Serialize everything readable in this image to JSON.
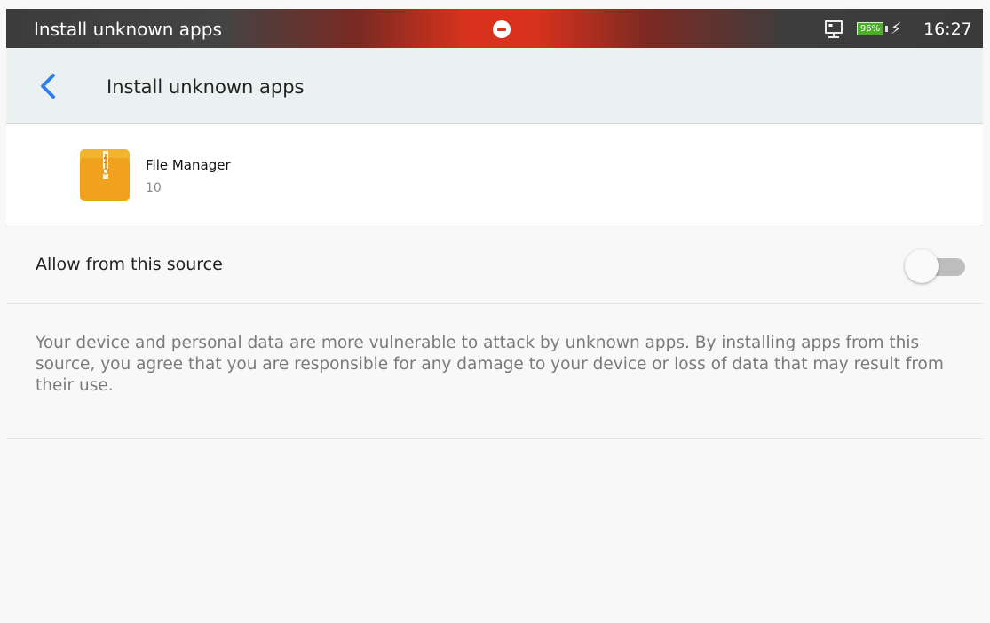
{
  "status_bar": {
    "title": "Install unknown apps",
    "battery_level": "96%",
    "time": "16:27",
    "icons": [
      "do-not-disturb-icon",
      "ethernet-icon",
      "battery-icon",
      "charging-icon"
    ]
  },
  "app_bar": {
    "back_icon": "chevron-left-icon",
    "title": "Install unknown apps"
  },
  "app_info": {
    "name": "File Manager",
    "version": "10",
    "icon": "file-manager-icon"
  },
  "setting": {
    "label": "Allow from this source",
    "enabled": false
  },
  "warning": {
    "text": "Your device and personal data are more vulnerable to attack by unknown apps. By installing apps from this source, you agree that you are responsible for any damage to your device or loss of data that may result from their use."
  },
  "colors": {
    "accent": "#2f80ed",
    "status_bar_red": "#d8321c",
    "app_bar_bg": "#ebf1f1",
    "battery_green": "#4caf28",
    "toggle_track_off": "#bdbdbd"
  }
}
